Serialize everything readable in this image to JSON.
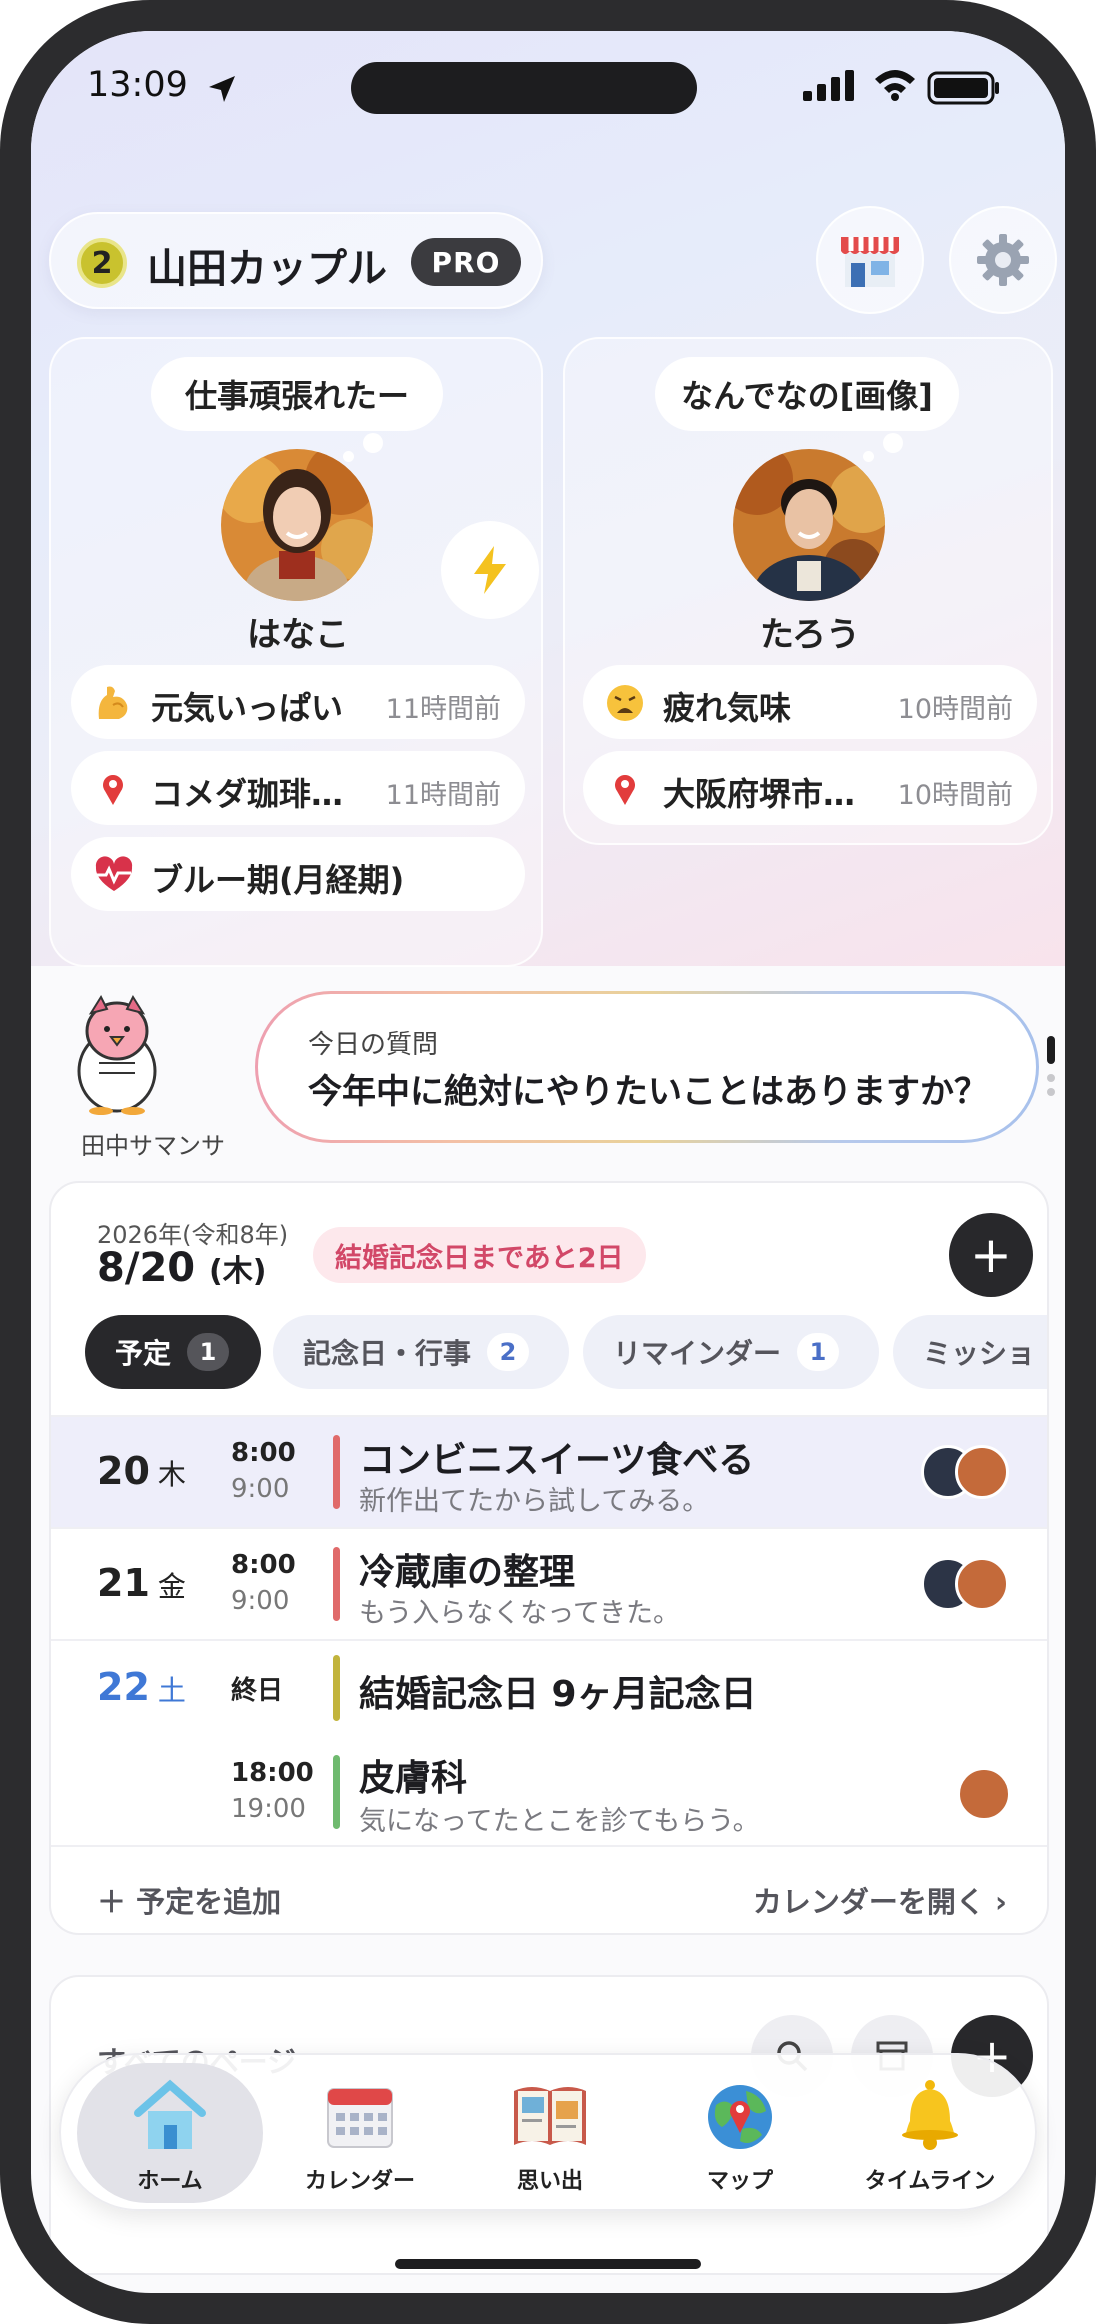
{
  "status_bar": {
    "time": "13:09"
  },
  "header": {
    "level": "2",
    "couple_name": "山田カップル",
    "plan_badge": "PRO"
  },
  "partners": [
    {
      "name": "はなこ",
      "thought": "仕事頑張れたー",
      "statuses": [
        {
          "icon": "flexed-biceps-icon",
          "text": "元気いっぱい",
          "ago": "11時間前"
        },
        {
          "icon": "location-pin-icon",
          "text": "コメダ珈琲…",
          "ago": "11時間前"
        },
        {
          "icon": "heart-pulse-icon",
          "text": "ブルー期(月経期)",
          "ago": ""
        }
      ]
    },
    {
      "name": "たろう",
      "thought": "なんでなの[画像]",
      "statuses": [
        {
          "icon": "weary-face-icon",
          "text": "疲れ気味",
          "ago": "10時間前"
        },
        {
          "icon": "location-pin-icon",
          "text": "大阪府堺市…",
          "ago": "10時間前"
        }
      ]
    }
  ],
  "question": {
    "mascot_name": "田中サマンサ",
    "label": "今日の質問",
    "text": "今年中に絶対にやりたいことはありますか？"
  },
  "schedule": {
    "year_label": "2026年(令和8年)",
    "date": "8/20",
    "weekday": "(木)",
    "anniversary_badge": "結婚記念日まであと2日",
    "tabs": [
      {
        "label": "予定",
        "count": "1",
        "active": true
      },
      {
        "label": "記念日・行事",
        "count": "2",
        "active": false
      },
      {
        "label": "リマインダー",
        "count": "1",
        "active": false
      },
      {
        "label": "ミッショ",
        "count": "",
        "active": false
      }
    ],
    "events": [
      {
        "day": "20",
        "weekday": "木",
        "start": "8:00",
        "end": "9:00",
        "title": "コンビニスイーツ食べる",
        "subtitle": "新作出てたから試してみる。",
        "color": "#e06a6a"
      },
      {
        "day": "21",
        "weekday": "金",
        "start": "8:00",
        "end": "9:00",
        "title": "冷蔵庫の整理",
        "subtitle": "もう入らなくなってきた。",
        "color": "#e06a6a"
      },
      {
        "day": "22",
        "weekday": "土",
        "allday": "終日",
        "title": "結婚記念日 9ヶ月記念日",
        "color": "#c2b43c"
      },
      {
        "start": "18:00",
        "end": "19:00",
        "title": "皮膚科",
        "subtitle": "気になってたとこを診てもらう。",
        "color": "#6fba6f"
      }
    ],
    "add_label": "予定を追加",
    "open_calendar_label": "カレンダーを開く"
  },
  "pages": {
    "title": "すべてのページ"
  },
  "bottom_nav": [
    {
      "label": "ホーム",
      "icon": "home-icon",
      "active": true
    },
    {
      "label": "カレンダー",
      "icon": "calendar-icon",
      "active": false
    },
    {
      "label": "思い出",
      "icon": "album-icon",
      "active": false
    },
    {
      "label": "マップ",
      "icon": "map-globe-icon",
      "active": false
    },
    {
      "label": "タイムライン",
      "icon": "bell-icon",
      "active": false
    }
  ]
}
